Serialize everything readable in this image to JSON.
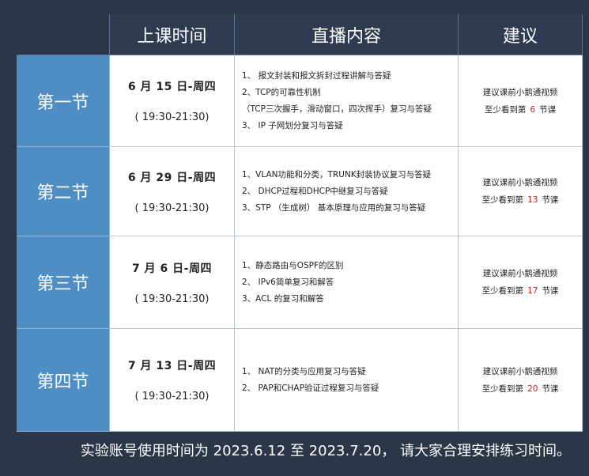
{
  "header": {
    "col_time": "上课时间",
    "col_content": "直播内容",
    "col_advice": "建议"
  },
  "rows": [
    {
      "section": "第一节",
      "date": "6 月 15 日-周四",
      "hours": "( 19:30-21:30)",
      "content": [
        "1、 报文封装和报文拆封过程讲解与答疑",
        "2、TCP的可靠性机制",
        "（TCP三次握手，滑动窗口，四次挥手）复习与答疑",
        "3、  IP 子网划分复习与答疑"
      ],
      "advice_line1": "建议课前小鹅通视频",
      "advice_prefix": "至少看到第",
      "advice_count": "6",
      "advice_suffix": "节课"
    },
    {
      "section": "第二节",
      "date": "6 月 29 日-周四",
      "hours": "( 19:30-21:30)",
      "content": [
        "1、VLAN功能和分类，TRUNK封装协议复习与答疑",
        "2、  DHCP过程和DHCP中继复习与答疑",
        "3、STP （生成树） 基本原理与应用的复习与答疑"
      ],
      "advice_line1": "建议课前小鹅通视频",
      "advice_prefix": "至少看到第",
      "advice_count": "13",
      "advice_suffix": "节课"
    },
    {
      "section": "第三节",
      "date": "7 月 6 日-周四",
      "hours": "( 19:30-21:30)",
      "content": [
        "1、静态路由与OSPF的区别",
        "2、  IPv6简单复习和解答",
        "3、ACL 的复习和解答"
      ],
      "advice_line1": "建议课前小鹅通视频",
      "advice_prefix": "至少看到第",
      "advice_count": "17",
      "advice_suffix": "节课"
    },
    {
      "section": "第四节",
      "date": "7 月 13 日-周四",
      "hours": "( 19:30-21:30)",
      "content": [
        "1、  NAT的分类与应用复习与答疑",
        "2、  PAP和CHAP验证过程复习与答疑"
      ],
      "advice_line1": "建议课前小鹅通视频",
      "advice_prefix": "至少看到第",
      "advice_count": "20",
      "advice_suffix": "节课"
    }
  ],
  "footnote": "实验账号使用时间为 2023.6.12 至 2023.7.20， 请大家合理安排练习时间。",
  "colors": {
    "background": "#2b3648",
    "header_bg": "#2e3b50",
    "section_bg": "#4e8ec5",
    "highlight": "#c0201e"
  }
}
